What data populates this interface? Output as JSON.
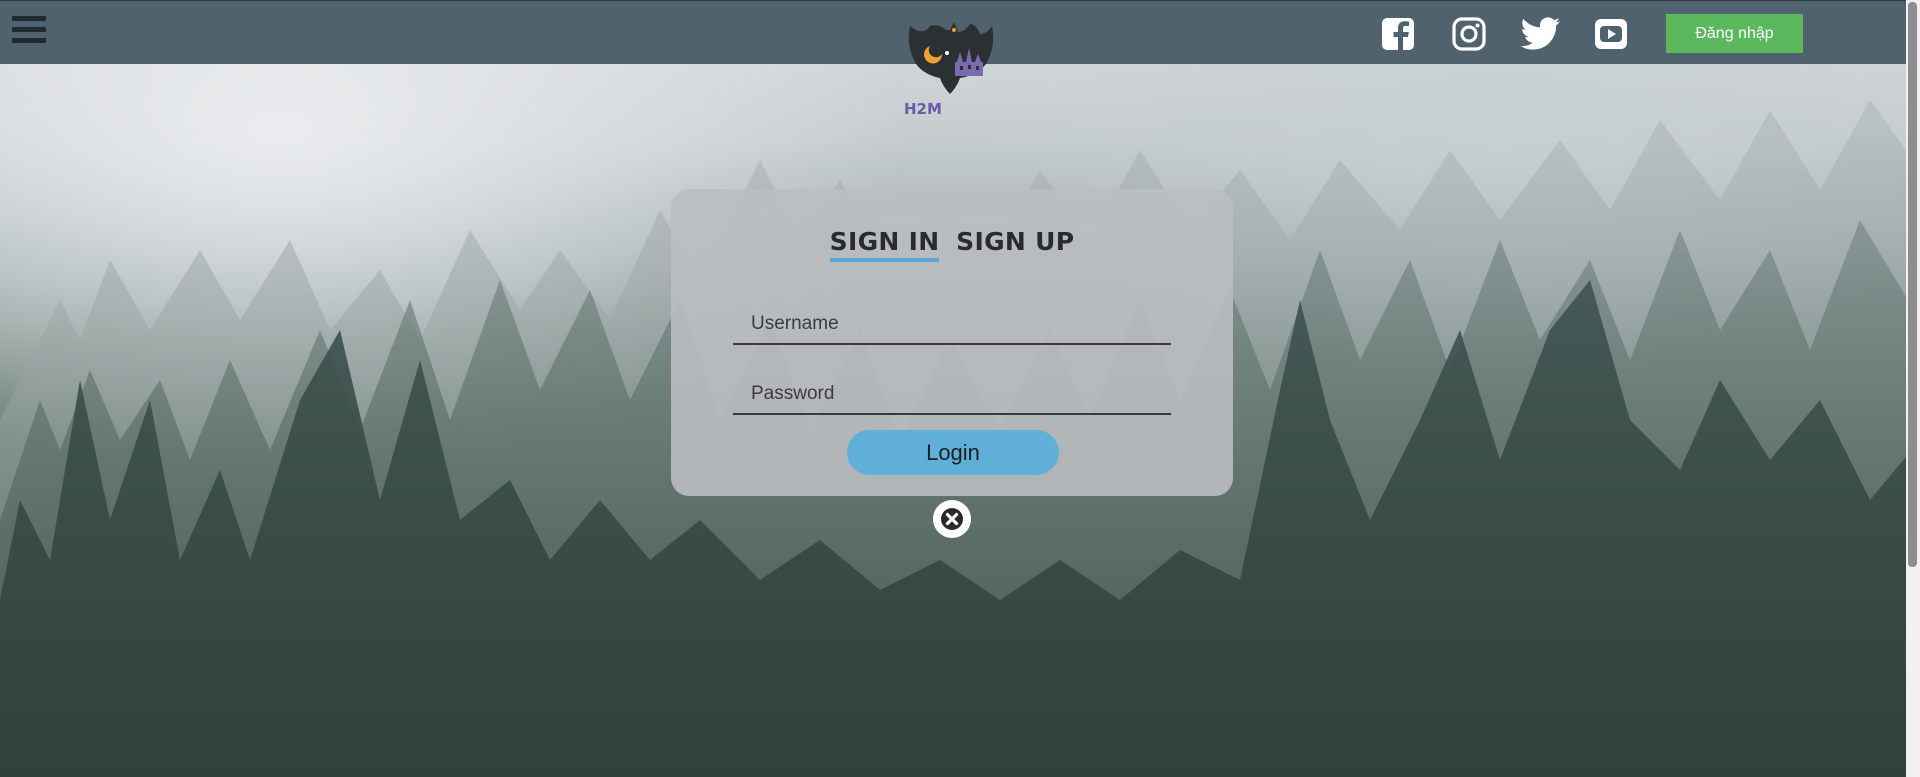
{
  "header": {
    "logo_text": "H2M",
    "menu_icon": "hamburger-menu-icon",
    "social": [
      {
        "name": "facebook",
        "icon": "facebook-icon"
      },
      {
        "name": "instagram",
        "icon": "instagram-icon"
      },
      {
        "name": "twitter",
        "icon": "twitter-icon"
      },
      {
        "name": "youtube",
        "icon": "youtube-icon"
      }
    ],
    "login_button": "Đăng nhập"
  },
  "login_card": {
    "tabs": [
      {
        "label": "SIGN IN",
        "active": true
      },
      {
        "label": "SIGN UP",
        "active": false
      }
    ],
    "username_placeholder": "Username",
    "password_placeholder": "Password",
    "submit_label": "Login",
    "close_icon": "close-icon"
  },
  "colors": {
    "topbar": "#4f626d",
    "login_button_bg": "#5cb85c",
    "accent_blue": "#60afd9"
  }
}
